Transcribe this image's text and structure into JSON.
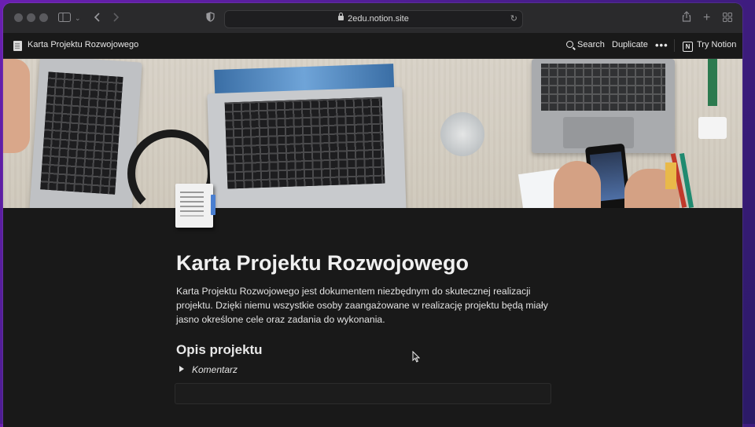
{
  "browser": {
    "url": "2edu.notion.site"
  },
  "topbar": {
    "breadcrumb": "Karta Projektu Rozwojowego",
    "search": "Search",
    "duplicate": "Duplicate",
    "more": "•••",
    "try_notion": "Try Notion"
  },
  "page": {
    "title": "Karta Projektu Rozwojowego",
    "intro": "Karta Projektu Rozwojowego jest dokumentem niezbędnym do skutecznej realizacji projektu. Dzięki niemu wszystkie osoby zaangażowane w realizację projektu będą miały jasno określone cele oraz zadania do wykonania.",
    "section_heading": "Opis projektu",
    "toggle_label": "Komentarz"
  },
  "colors": {
    "background": "#191919",
    "text": "#e3e3e3",
    "desktop": "#5b1fa3"
  }
}
